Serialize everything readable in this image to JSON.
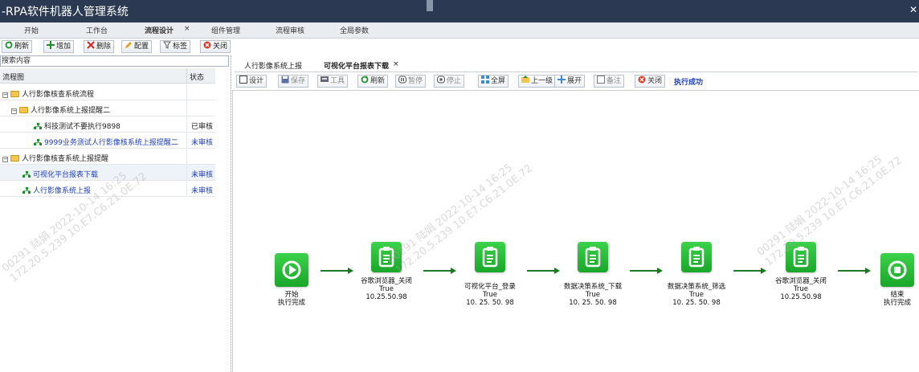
{
  "window": {
    "title": "-RPA软件机器人管理系统",
    "close_glyph": "✕"
  },
  "menu": {
    "tabs": [
      "开始",
      "工作台",
      "流程设计",
      "组件管理",
      "流程审核",
      "全局参数"
    ],
    "close_glyph": "×"
  },
  "toolbar": {
    "refresh": "刷新",
    "add": "增加",
    "delete": "删除",
    "config": "配置",
    "tag": "标签",
    "close": "关闭"
  },
  "search": {
    "placeholder": "搜索内容"
  },
  "tree": {
    "col_flow": "流程图",
    "col_status": "状态",
    "rows": [
      {
        "label": "人行影像核查系统流程",
        "status": ""
      },
      {
        "label": "人行影像系统上报提醒二",
        "status": ""
      },
      {
        "label": "科技测试不要执行9898",
        "status": "已审核"
      },
      {
        "label": "9999业务测试人行影像核系统上报提醒二",
        "status": "未审核"
      },
      {
        "label": "人行影像核查系统上报提醒",
        "status": ""
      },
      {
        "label": "可视化平台报表下载",
        "status": "未审核"
      },
      {
        "label": "人行影像系统上报",
        "status": "未审核"
      }
    ]
  },
  "right_tabs": {
    "tab1": "人行影像系统上报",
    "tab2": "可视化平台报表下载",
    "close_glyph": "×"
  },
  "right_toolbar": {
    "design": "设计",
    "save": "保存",
    "tools": "工具",
    "refresh": "刷新",
    "pause": "暂停",
    "stop": "停止",
    "fullscreen": "全屏",
    "up": "上一级",
    "expand": "展开",
    "note": "备注",
    "close": "关闭",
    "status": "执行成功"
  },
  "flow": {
    "nodes": [
      {
        "line1": "开始",
        "line2": "执行完成",
        "line3": ""
      },
      {
        "line1": "谷歌浏览器_关闭",
        "line2": "True",
        "line3": "10.25.50.98"
      },
      {
        "line1": "可视化平台_登录",
        "line2": "True",
        "line3": "10. 25. 50. 98"
      },
      {
        "line1": "数据决策系统_下载",
        "line2": "True",
        "line3": "10. 25. 50. 98"
      },
      {
        "line1": "数据决策系统_筛选",
        "line2": "True",
        "line3": "10. 25. 50. 98"
      },
      {
        "line1": "谷歌浏览器_关闭",
        "line2": "True",
        "line3": "10.25.50.98"
      },
      {
        "line1": "结束",
        "line2": "执行完成",
        "line3": ""
      }
    ]
  },
  "watermark": {
    "line1": "00291 陆娟 2022-10-14 16:25",
    "line2": "172.20.5.239  10.E7.C6.21.0E.72"
  },
  "colors": {
    "titlebar": "#2b3a52",
    "node_green": "#22b832",
    "link_blue": "#1f3fb0"
  },
  "icons": [
    "refresh-icon",
    "add-icon",
    "delete-icon",
    "config-icon",
    "tag-icon",
    "close-circle-icon",
    "folder-icon",
    "flow-icon",
    "play-icon",
    "clipboard-icon",
    "stop-icon"
  ]
}
